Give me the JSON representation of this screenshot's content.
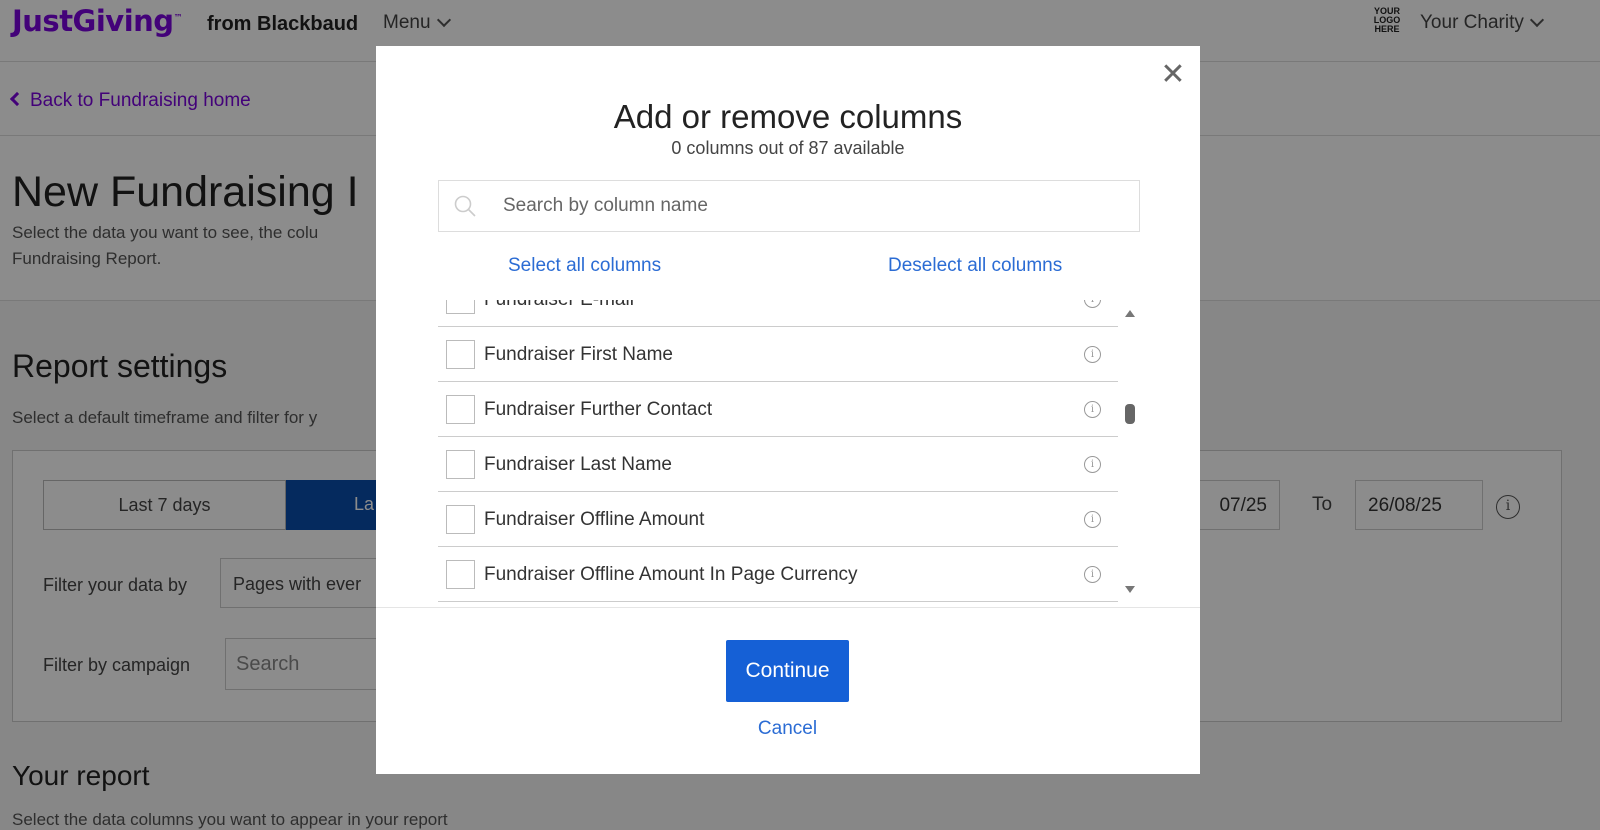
{
  "header": {
    "logo": "JustGiving",
    "logo_tm": "™",
    "logo_sub": "from Blackbaud",
    "menu_label": "Menu",
    "your_logo_line1": "YOUR",
    "your_logo_line2": "LOGO",
    "your_logo_line3": "HERE",
    "charity_label": "Your Charity"
  },
  "page": {
    "back_link": "Back to Fundraising home",
    "title": "New Fundraising I",
    "description": "Select the data you want to see, the colu Fundraising Report.",
    "settings_title": "Report settings",
    "settings_description": "Select a default timeframe and filter for y",
    "timeframe_option_1": "Last 7 days",
    "timeframe_option_2": "La",
    "filter_label": "Filter your data by",
    "filter_value": "Pages with ever",
    "campaign_label": "Filter by campaign",
    "campaign_placeholder": "Search",
    "from_date": "07/25",
    "to_label": "To",
    "to_date": "26/08/25",
    "report_title": "Your report",
    "report_description": "Select the data columns you want to appear in your report"
  },
  "modal": {
    "title": "Add or remove columns",
    "subtitle": "0 columns out of 87 available",
    "search_placeholder": "Search by column name",
    "select_all": "Select all columns",
    "deselect_all": "Deselect all columns",
    "columns": [
      {
        "label": "Fundraiser E-mail",
        "checked": false
      },
      {
        "label": "Fundraiser First Name",
        "checked": false
      },
      {
        "label": "Fundraiser Further Contact",
        "checked": false
      },
      {
        "label": "Fundraiser Last Name",
        "checked": false
      },
      {
        "label": "Fundraiser Offline Amount",
        "checked": false
      },
      {
        "label": "Fundraiser Offline Amount In Page Currency",
        "checked": false
      }
    ],
    "continue_label": "Continue",
    "cancel_label": "Cancel",
    "close_glyph": "✕"
  },
  "colors": {
    "brand_purple": "#7a04dd",
    "primary_blue": "#1560d6",
    "link_blue": "#2b6cd4",
    "selected_segment": "#0a4dab"
  },
  "icons": {
    "search": "search-icon",
    "close": "close-icon",
    "info": "info-icon",
    "chevron": "chevron-down-icon"
  }
}
